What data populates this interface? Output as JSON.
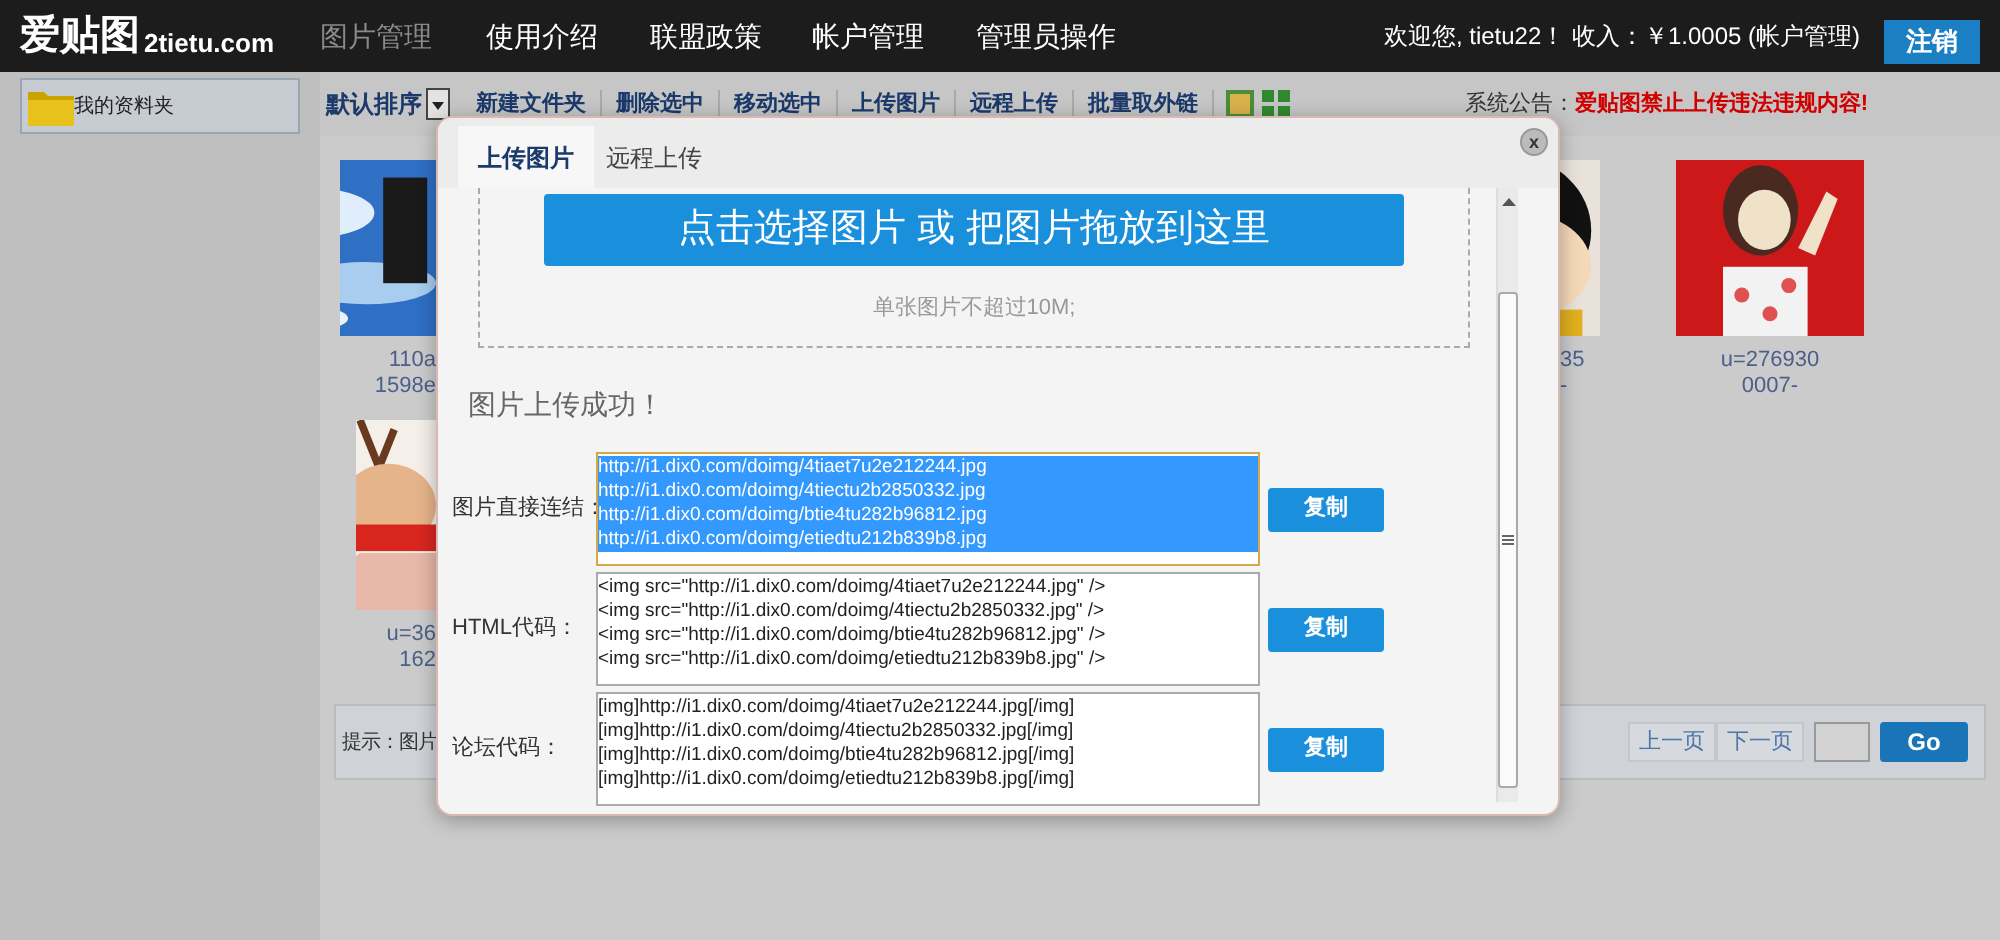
{
  "header": {
    "logo": "爱贴图",
    "domain": "2tietu.com",
    "nav": [
      {
        "label": "图片管理",
        "selected": true
      },
      {
        "label": "使用介绍",
        "selected": false
      },
      {
        "label": "联盟政策",
        "selected": false
      },
      {
        "label": "帐户管理",
        "selected": false
      },
      {
        "label": "管理员操作",
        "selected": false
      }
    ],
    "welcome": "欢迎您, tietu22！ 收入：￥1.0005 (帐户管理)",
    "logout": "注销"
  },
  "toolbar": {
    "folder": "我的资料夹",
    "sort": "默认排序",
    "actions": [
      "新建文件夹",
      "删除选中",
      "移动选中",
      "上传图片",
      "远程上传",
      "批量取外链"
    ],
    "notice_label": "系统公告：",
    "notice": "爱贴图禁止上传违法违规内容!"
  },
  "gallery": [
    {
      "caption": [
        "110a",
        "1598e"
      ]
    },
    {
      "caption": [
        "35",
        "-"
      ]
    },
    {
      "caption": [
        "u=276930",
        "0007-"
      ]
    },
    {
      "caption": [
        "u=36",
        "162"
      ]
    }
  ],
  "hint_bar": {
    "hint": "提示：图片",
    "prev": "上一页",
    "next": "下一页",
    "go": "Go"
  },
  "dialog": {
    "tabs": [
      {
        "label": "上传图片",
        "selected": true
      },
      {
        "label": "远程上传",
        "selected": false
      }
    ],
    "close": "x",
    "pick_button": "点击选择图片 或 把图片拖放到这里",
    "size_hint": "单张图片不超过10M;",
    "success": "图片上传成功！",
    "fields": [
      {
        "label": "图片直接连结：",
        "selected": true,
        "button": "复制",
        "lines": [
          "http://i1.dix0.com/doimg/4tiaet7u2e212244.jpg",
          "http://i1.dix0.com/doimg/4tiectu2b2850332.jpg",
          "http://i1.dix0.com/doimg/btie4tu282b96812.jpg",
          "http://i1.dix0.com/doimg/etiedtu212b839b8.jpg"
        ]
      },
      {
        "label": "HTML代码：",
        "selected": false,
        "button": "复制",
        "lines": [
          "<img src=\"http://i1.dix0.com/doimg/4tiaet7u2e212244.jpg\" />",
          "<img src=\"http://i1.dix0.com/doimg/4tiectu2b2850332.jpg\" />",
          "<img src=\"http://i1.dix0.com/doimg/btie4tu282b96812.jpg\" />",
          "<img src=\"http://i1.dix0.com/doimg/etiedtu212b839b8.jpg\" />"
        ]
      },
      {
        "label": "论坛代码：",
        "selected": false,
        "button": "复制",
        "lines": [
          "[img]http://i1.dix0.com/doimg/4tiaet7u2e212244.jpg[/img]",
          "[img]http://i1.dix0.com/doimg/4tiectu2b2850332.jpg[/img]",
          "[img]http://i1.dix0.com/doimg/btie4tu282b96812.jpg[/img]",
          "[img]http://i1.dix0.com/doimg/etiedtu212b839b8.jpg[/img]"
        ]
      }
    ]
  }
}
